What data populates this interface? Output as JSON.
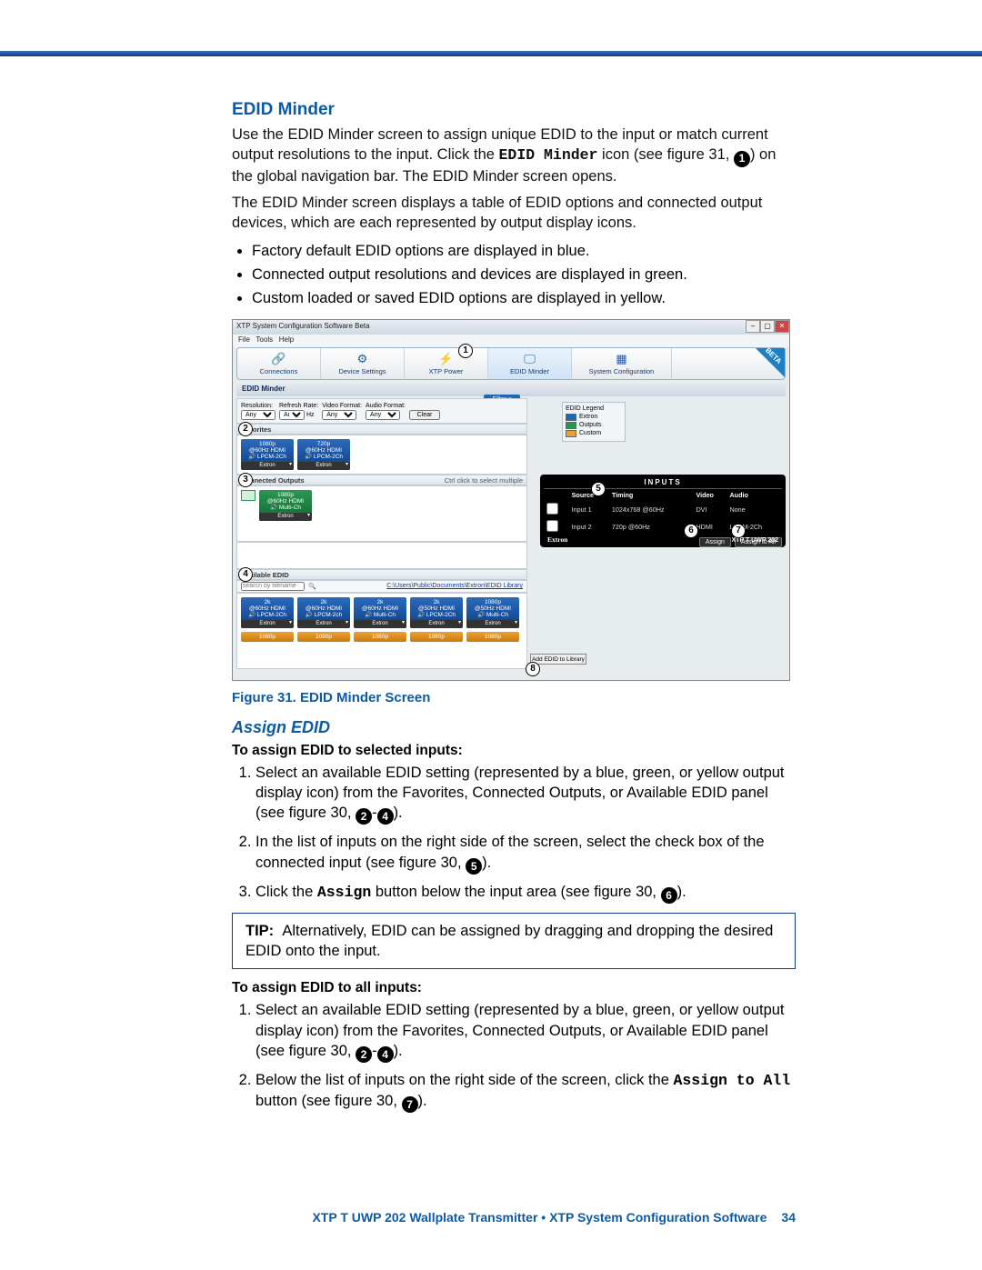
{
  "headings": {
    "edid_minder": "EDID Minder",
    "assign_edid": "Assign EDID"
  },
  "paragraphs": {
    "p1a": "Use the EDID Minder screen to assign unique EDID to the input or match current output resolutions to the input. Click the ",
    "p1_code": "EDID Minder",
    "p1b": " icon (see figure 31, ",
    "p1c": ") on the global navigation bar. The EDID Minder screen opens.",
    "p2": "The EDID Minder screen displays a table of EDID options and connected output devices, which are each represented by output display icons."
  },
  "bullets": {
    "b1": "Factory default EDID options are displayed in blue.",
    "b2": "Connected output resolutions and devices are displayed in green.",
    "b3": "Custom loaded or saved EDID options are displayed in yellow."
  },
  "callouts": {
    "c1": "1",
    "c2": "2",
    "c3": "3",
    "c4": "4",
    "c5": "5",
    "c6": "6",
    "c7": "7",
    "c8": "8"
  },
  "screenshot": {
    "window_title": "XTP System Configuration Software Beta",
    "menus": [
      "File",
      "Tools",
      "Help"
    ],
    "toolbar": [
      "Connections",
      "Device Settings",
      "XTP Power",
      "EDID Minder",
      "System Configuration"
    ],
    "beta": "BETA",
    "subheader": "EDID Minder",
    "filter_btn": "Filter ▾",
    "filters": {
      "labels": [
        "Resolution:",
        "Refresh Rate:",
        "Video Format:",
        "Audio Format:"
      ],
      "values": [
        "Any",
        "Any",
        "Any",
        "Any"
      ],
      "hz": "Hz",
      "clear": "Clear"
    },
    "sections": {
      "favorites": "Favorites",
      "connected": "Connected Outputs",
      "connected_hint": "Ctrl click to select multiple",
      "available": "Available EDID"
    },
    "fav_tiles": [
      {
        "l1": "1080p",
        "l2": "@60Hz HDMI",
        "l3": "🔊 LPCM-2Ch",
        "foot": "Extron"
      },
      {
        "l1": "720p",
        "l2": "@60Hz HDMI",
        "l3": "🔊 LPCM-2Ch",
        "foot": "Extron"
      }
    ],
    "conn_tiles": [
      {
        "l1": "1080p",
        "l2": "@60Hz HDMI",
        "l3": "🔊 Multi-Ch",
        "foot": "Extron"
      }
    ],
    "search_placeholder": "search by filename",
    "library_path": "C:\\Users\\Public\\Documents\\Extron\\EDID Library",
    "avail_tiles": [
      {
        "l1": "2k",
        "l2": "@60Hz HDMI",
        "l3": "🔊 LPCM-2Ch",
        "foot": "Extron"
      },
      {
        "l1": "2k",
        "l2": "@60Hz HDMI",
        "l3": "🔊 LPCM-2ch",
        "foot": "Extron"
      },
      {
        "l1": "2k",
        "l2": "@60Hz HDMI",
        "l3": "🔊 Multi-Ch",
        "foot": "Extron"
      },
      {
        "l1": "2k",
        "l2": "@50Hz HDMI",
        "l3": "🔊 LPCM-2Ch",
        "foot": "Extron"
      },
      {
        "l1": "1080p",
        "l2": "@50Hz HDMI",
        "l3": "🔊 Multi-Ch",
        "foot": "Extron"
      },
      {
        "l1": "1080p"
      },
      {
        "l1": "1080p"
      },
      {
        "l1": "1080p"
      },
      {
        "l1": "1080p"
      },
      {
        "l1": "1080p"
      }
    ],
    "add_btn": "Add EDID to Library",
    "legend": {
      "title": "EDID Legend",
      "items": [
        "Extron",
        "Outputs",
        "Custom"
      ]
    },
    "inputs": {
      "title": "INPUTS",
      "headers": [
        "Source",
        "Timing",
        "Video",
        "Audio"
      ],
      "rows": [
        [
          "Input 1",
          "1024x768 @60Hz",
          "DVI",
          "None"
        ],
        [
          "Input 2",
          "720p @60Hz",
          "HDMI",
          "LPCM-2Ch"
        ]
      ],
      "assign": "Assign",
      "assign_all": "Assign to All",
      "brand": "Extron",
      "model": "XTP T UWP 202"
    }
  },
  "figure_caption": "Figure 31.  EDID Minder Screen",
  "bold": {
    "selected": "To assign EDID to selected inputs:",
    "all": "To assign EDID to all inputs:"
  },
  "steps": {
    "sel": {
      "0a": "Select an available EDID setting (represented by a blue, green, or yellow output display icon) from the Favorites, Connected Outputs, or Available EDID panel (see figure 30, ",
      "0b": ").",
      "1a": "In the list of inputs on the right side of the screen, select the check box of the connected input (see figure 30, ",
      "1b": ").",
      "2a": "Click the ",
      "2code": "Assign",
      "2b": " button below the input area (see figure 30, ",
      "2c": ")."
    },
    "all": {
      "0a": "Select an available EDID setting (represented by a blue, green, or yellow output display icon) from the Favorites, Connected Outputs, or Available EDID panel (see figure 30, ",
      "0b": ").",
      "1a": "Below the list of inputs on the right side of the screen, click the ",
      "1code": "Assign to All",
      "1b": " button (see figure 30, ",
      "1c": ")."
    }
  },
  "tip": {
    "label": "TIP:",
    "text": "Alternatively, EDID can be assigned by dragging and dropping the desired EDID onto the input."
  },
  "footer": {
    "text": "XTP T UWP 202 Wallplate Transmitter • XTP System Configuration Software",
    "page": "34"
  }
}
